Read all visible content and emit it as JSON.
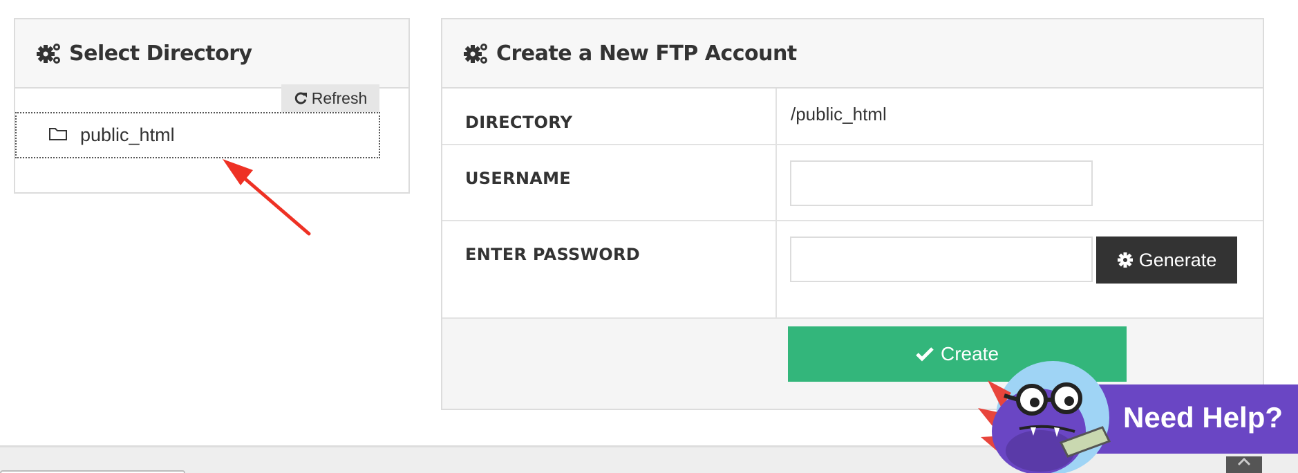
{
  "select_directory": {
    "title": "Select Directory",
    "refresh_label": "Refresh",
    "directories": [
      {
        "name": "public_html"
      }
    ]
  },
  "create_ftp": {
    "title": "Create a New FTP Account",
    "fields": {
      "directory": {
        "label": "DIRECTORY",
        "value": "/public_html"
      },
      "username": {
        "label": "USERNAME",
        "value": "",
        "placeholder": ""
      },
      "password": {
        "label": "ENTER PASSWORD",
        "value": "",
        "placeholder": ""
      }
    },
    "generate_label": "Generate",
    "create_label": "Create"
  },
  "help_widget": {
    "label": "Need Help?"
  },
  "colors": {
    "create_green": "#33b67b",
    "generate_dark": "#333333",
    "help_purple": "#6a46c4",
    "annotation_red": "#ee3124"
  },
  "icons": [
    "gears-icon",
    "refresh-icon",
    "folder-icon",
    "gear-icon",
    "check-icon",
    "chevron-up-icon"
  ]
}
